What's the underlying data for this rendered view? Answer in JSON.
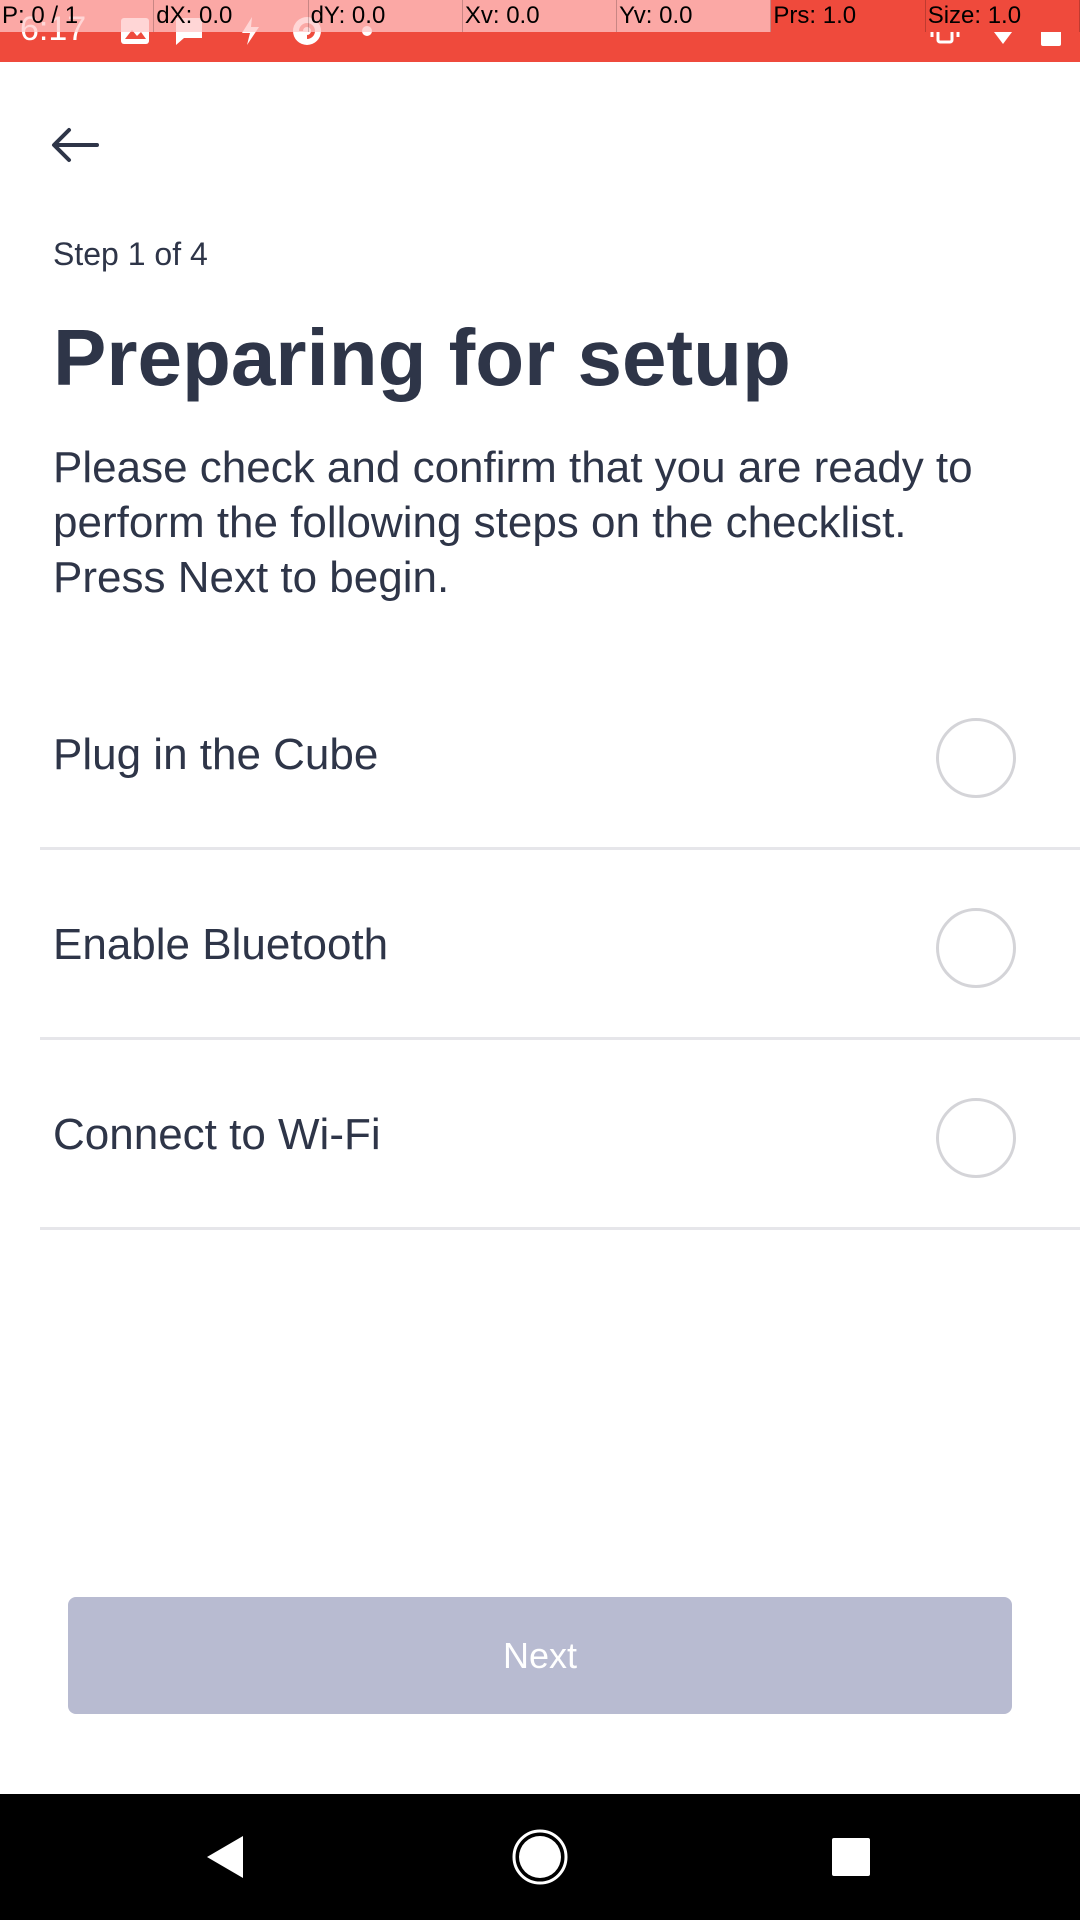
{
  "status_bar": {
    "time": "6:17",
    "pointer_overlay": [
      "P: 0 / 1",
      "dX: 0.0",
      "dY: 0.0",
      "Xv: 0.0",
      "Yv: 0.0",
      "Prs: 1.0",
      "Size: 1.0"
    ],
    "colors": {
      "background": "#ef4a3c",
      "overlay": "#ffc8c8"
    }
  },
  "header": {
    "back_icon": "arrow-left-icon",
    "step": "Step 1 of 4",
    "title": "Preparing for setup",
    "description": "Please check and confirm that you are ready to perform the following steps on the checklist. Press Next to begin."
  },
  "checklist": {
    "items": [
      {
        "label": "Plug in the Cube",
        "checked": false
      },
      {
        "label": "Enable Bluetooth",
        "checked": false
      },
      {
        "label": "Connect to Wi-Fi",
        "checked": false
      }
    ]
  },
  "footer": {
    "next_label": "Next",
    "next_enabled": false,
    "next_color": "#b8bbd1"
  },
  "nav_bar": {
    "icons": [
      "back-triangle-icon",
      "home-circle-icon",
      "recents-square-icon"
    ]
  },
  "theme": {
    "text": "#2e3548",
    "divider": "#e6e6ea",
    "radio_border": "#d4d4d8"
  }
}
